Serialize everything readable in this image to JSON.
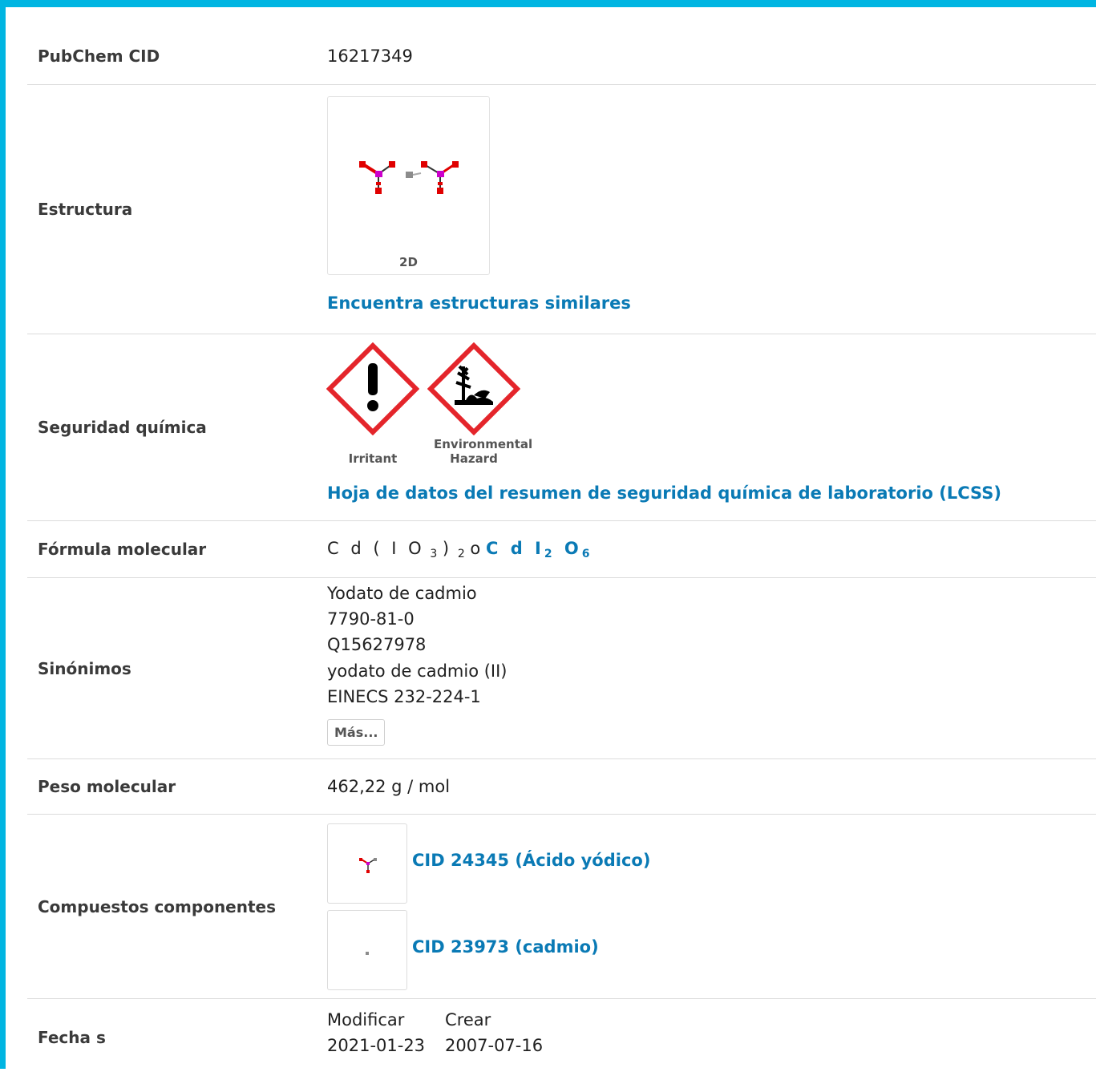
{
  "colors": {
    "accent_border": "#00b5e2",
    "link": "#0a7ab5",
    "hazard_red": "#e4252b"
  },
  "rows": {
    "cid": {
      "label": "PubChem CID",
      "value": "16217349"
    },
    "structure": {
      "label": "Estructura",
      "caption": "2D",
      "link": "Encuentra estructuras similares"
    },
    "safety": {
      "label": "Seguridad química",
      "pictograms": [
        {
          "name": "Irritant",
          "icon": "exclamation-mark-icon"
        },
        {
          "name": "Environmental Hazard",
          "icon": "environment-icon"
        }
      ],
      "link": "Hoja de datos del resumen de seguridad química de laboratorio (LCSS)"
    },
    "formula": {
      "label": "Fórmula molecular",
      "plain": [
        "C d ( I O",
        "3",
        ")",
        "2",
        "o"
      ],
      "linked": [
        "C d I",
        "2",
        "O",
        "6"
      ]
    },
    "synonyms": {
      "label": "Sinónimos",
      "items": [
        "Yodato de cadmio",
        "7790-81-0",
        "Q15627978",
        "yodato de cadmio (II)",
        "EINECS 232-224-1"
      ],
      "more_button": "Más..."
    },
    "weight": {
      "label": "Peso molecular",
      "value": "462,22 g / mol"
    },
    "components": {
      "label": "Compuestos componentes",
      "items": [
        {
          "link": "CID 24345 (Ácido yódico)"
        },
        {
          "link": "CID 23973 (cadmio)"
        }
      ]
    },
    "dates": {
      "label": "Fecha s",
      "headers": [
        "Modificar",
        "Crear"
      ],
      "values": [
        "2021-01-23",
        "2007-07-16"
      ]
    }
  }
}
